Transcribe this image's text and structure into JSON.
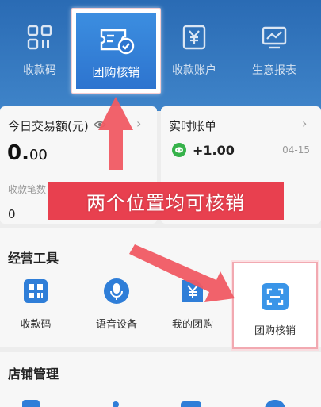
{
  "top_nav": {
    "items": [
      {
        "label": "收款码",
        "icon": "qr-code-icon"
      },
      {
        "label": "团购核销",
        "icon": "ticket-check-icon"
      },
      {
        "label": "收款账户",
        "icon": "yen-account-icon"
      },
      {
        "label": "生意报表",
        "icon": "chart-report-icon"
      }
    ]
  },
  "today_card": {
    "title": "今日交易额(元)",
    "amount_main": "0.",
    "amount_decimals": "00",
    "count_label": "收款笔数",
    "count_value": "0",
    "second_label": "",
    "second_value": "0"
  },
  "realtime_card": {
    "title": "实时账单",
    "amount": "+1.00",
    "date": "04-15"
  },
  "annotation": "两个位置均可核销",
  "operations": {
    "title": "经营工具",
    "tools": [
      {
        "label": "收款码",
        "icon": "qr-code-icon"
      },
      {
        "label": "语音设备",
        "icon": "microphone-icon"
      },
      {
        "label": "我的团购",
        "icon": "group-buy-icon"
      },
      {
        "label": "团购核销",
        "icon": "scan-frame-icon"
      }
    ]
  },
  "store": {
    "title": "店铺管理"
  },
  "colors": {
    "header_blue": "#2a6bb4",
    "accent_blue": "#2d74cf",
    "highlight_red": "#e8404f",
    "wechat_green": "#36b24a"
  }
}
